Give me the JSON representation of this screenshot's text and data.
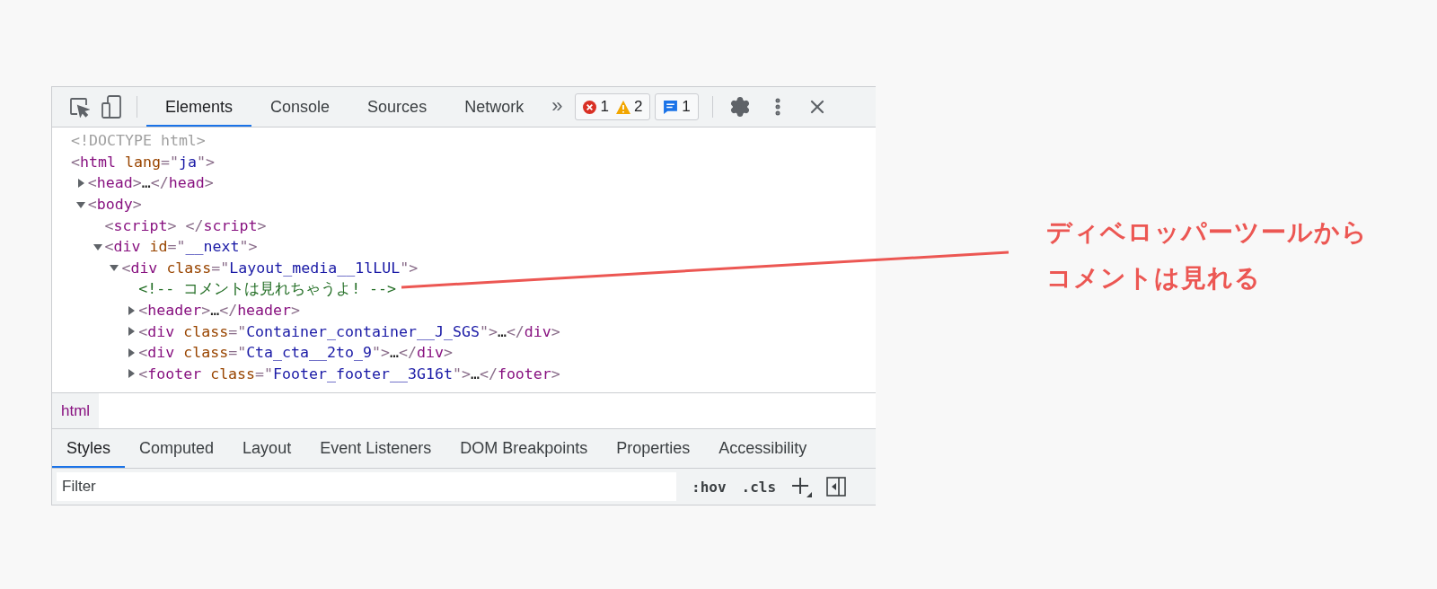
{
  "toolbar": {
    "tabs": [
      {
        "label": "Elements",
        "selected": true
      },
      {
        "label": "Console",
        "selected": false
      },
      {
        "label": "Sources",
        "selected": false
      },
      {
        "label": "Network",
        "selected": false
      }
    ],
    "more": "»",
    "issues": {
      "errors": "1",
      "warnings": "2"
    },
    "messages": "1"
  },
  "dom_tree": [
    {
      "kind": "doctype",
      "text": "<!DOCTYPE html>",
      "toggle": false
    },
    {
      "kind": "element",
      "text": "<html lang=\"ja\">",
      "toggle": false,
      "children": [
        {
          "kind": "element",
          "text": "<head>…</head>",
          "toggle": true,
          "expanded": false
        },
        {
          "kind": "element",
          "text": "<body>",
          "toggle": true,
          "expanded": true,
          "children": [
            {
              "kind": "element",
              "text": "<script> </script>",
              "toggle": false
            },
            {
              "kind": "element",
              "text": "<div id=\"__next\">",
              "toggle": true,
              "expanded": true,
              "children": [
                {
                  "kind": "element",
                  "text": "<div class=\"Layout_media__1lLUL\">",
                  "toggle": true,
                  "expanded": true,
                  "children": [
                    {
                      "kind": "comment",
                      "text": "<!-- コメントは見れちゃうよ! -->",
                      "toggle": false
                    },
                    {
                      "kind": "element",
                      "text": "<header>…</header>",
                      "toggle": true,
                      "expanded": false
                    },
                    {
                      "kind": "element",
                      "text": "<div class=\"Container_container__J_SGS\">…</div>",
                      "toggle": true,
                      "expanded": false
                    },
                    {
                      "kind": "element",
                      "text": "<div class=\"Cta_cta__2to_9\">…</div>",
                      "toggle": true,
                      "expanded": false
                    },
                    {
                      "kind": "element",
                      "text": "<footer class=\"Footer_footer__3G16t\">…</footer>",
                      "toggle": true,
                      "expanded": false
                    }
                  ]
                }
              ]
            }
          ]
        }
      ]
    }
  ],
  "breadcrumb": [
    {
      "label": "html",
      "selected": true
    }
  ],
  "sidebar_tabs": [
    {
      "label": "Styles",
      "selected": true
    },
    {
      "label": "Computed",
      "selected": false
    },
    {
      "label": "Layout",
      "selected": false
    },
    {
      "label": "Event Listeners",
      "selected": false
    },
    {
      "label": "DOM Breakpoints",
      "selected": false
    },
    {
      "label": "Properties",
      "selected": false
    },
    {
      "label": "Accessibility",
      "selected": false
    }
  ],
  "filter": {
    "placeholder": "Filter",
    "hov": ":hov",
    "cls": ".cls"
  },
  "annotation": {
    "lines": [
      "ディベロッパーツールから",
      "コメントは見れる"
    ]
  }
}
